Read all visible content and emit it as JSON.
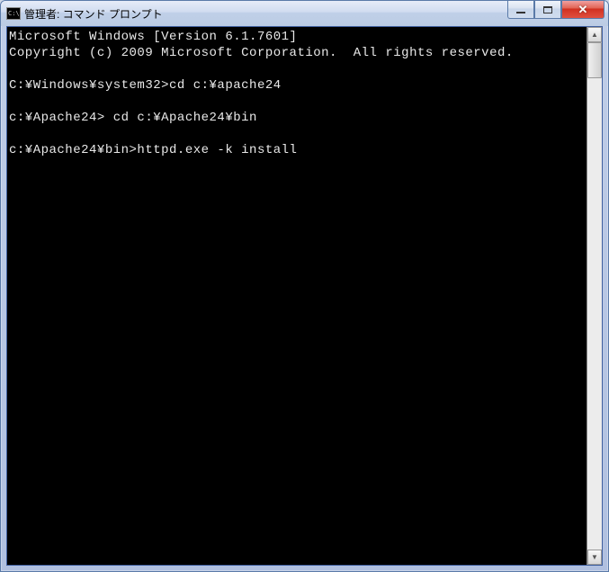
{
  "window": {
    "title": "管理者: コマンド プロンプト",
    "icon_text": "C:\\"
  },
  "console": {
    "lines": [
      "Microsoft Windows [Version 6.1.7601]",
      "Copyright (c) 2009 Microsoft Corporation.  All rights reserved.",
      "",
      "C:\\Windows\\system32>cd c:\\apache24",
      "",
      "c:\\Apache24> cd c:\\Apache24\\bin",
      "",
      "c:\\Apache24\\bin>httpd.exe -k install"
    ]
  }
}
